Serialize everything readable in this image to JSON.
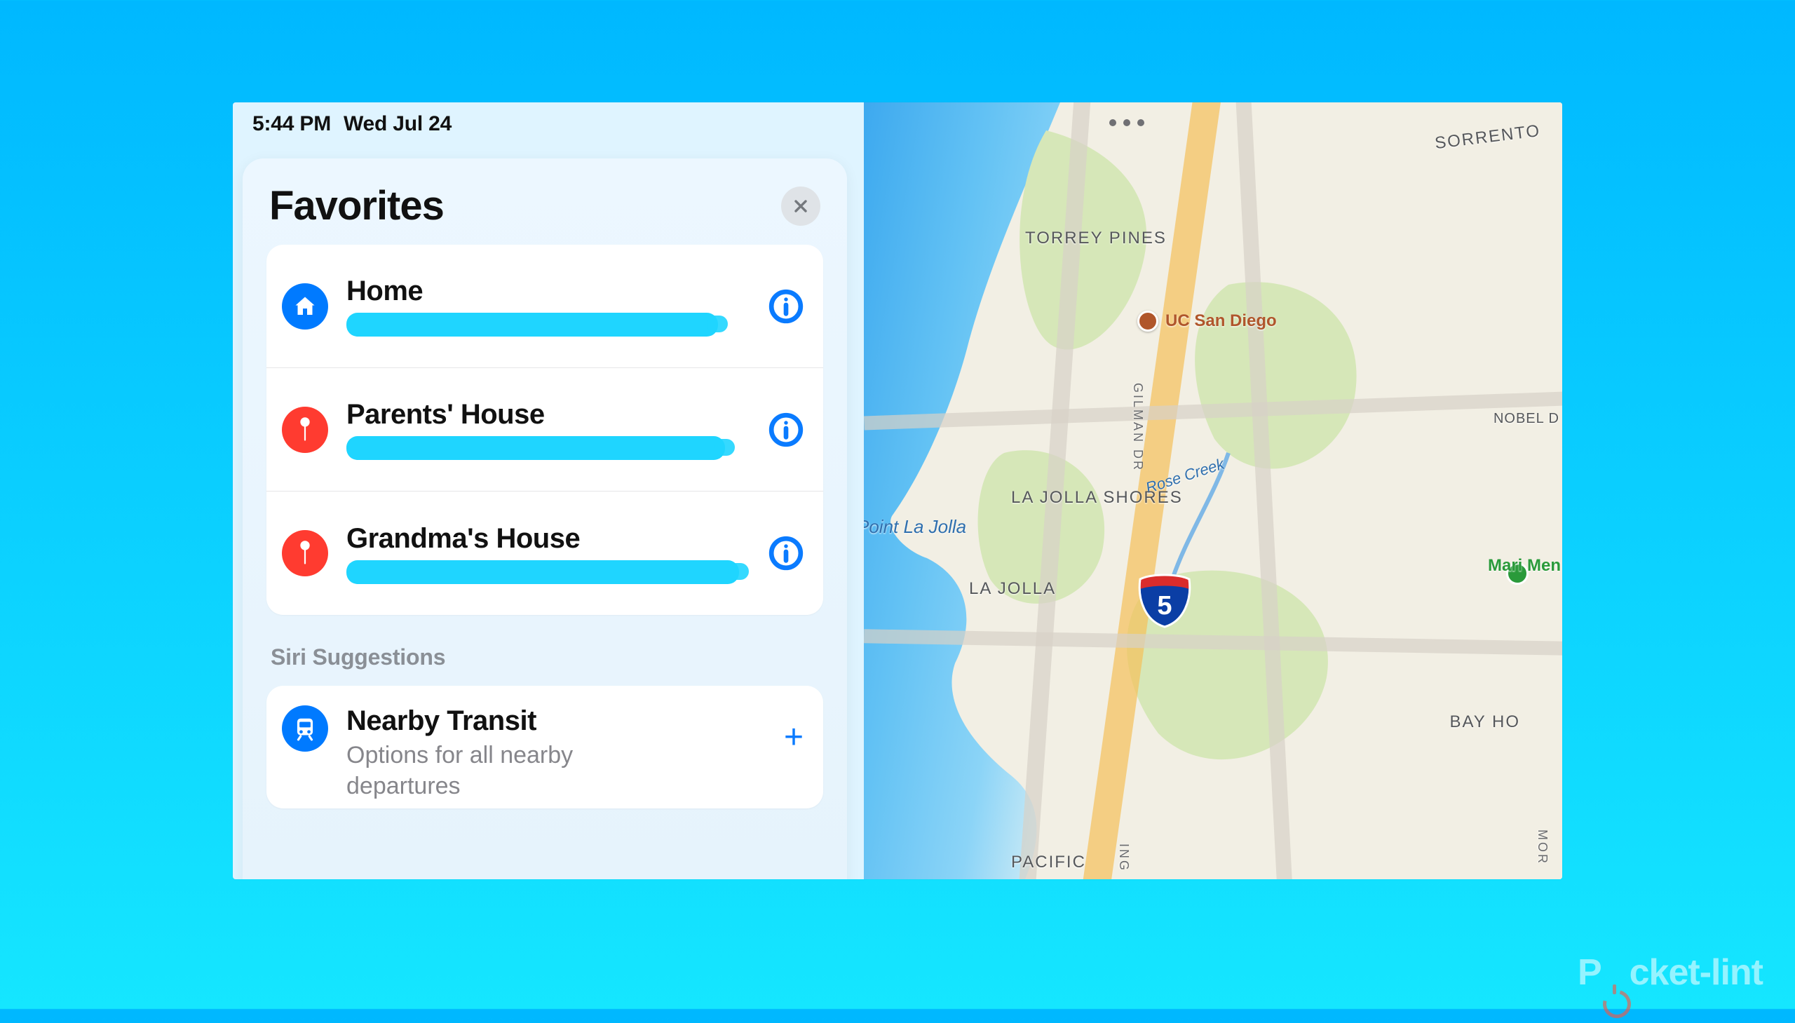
{
  "status": {
    "time": "5:44 PM",
    "date": "Wed Jul 24"
  },
  "panel": {
    "title": "Favorites",
    "favorites": [
      {
        "label": "Home",
        "icon": "home",
        "color": "blue"
      },
      {
        "label": "Parents' House",
        "icon": "pin",
        "color": "red"
      },
      {
        "label": "Grandma's House",
        "icon": "pin",
        "color": "red"
      }
    ],
    "section_label": "Siri Suggestions",
    "suggestion": {
      "title": "Nearby Transit",
      "subtitle": "Options for all nearby departures",
      "icon": "transit"
    }
  },
  "map": {
    "labels": {
      "sorrento": "SORRENTO",
      "torrey": "TORREY PINES",
      "ucsd": "UC San Diego",
      "nobel": "NOBEL D",
      "gilman": "GILMAN DR",
      "rose": "Rose Creek",
      "lajolla_shores": "LA JOLLA SHORES",
      "point_la_jolla": "Point La Jolla",
      "la_jolla": "LA JOLLA",
      "marian": "Mari Men",
      "bay_ho": "BAY HO",
      "pacific": "PACIFIC",
      "morena": "MOR",
      "ingraham": "ING"
    },
    "interstate": "5"
  },
  "watermark": "Pocket-lint"
}
